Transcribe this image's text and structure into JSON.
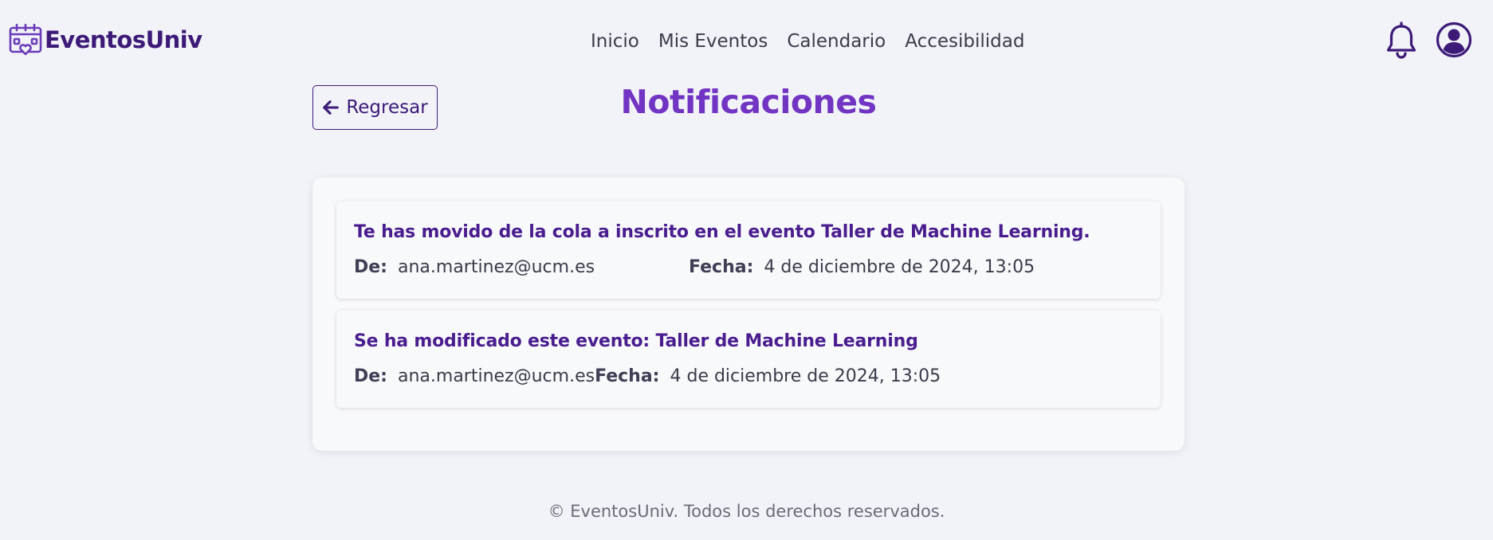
{
  "brand": {
    "name": "EventosUniv",
    "icon": "calendar-heart-icon"
  },
  "nav": {
    "links": [
      "Inicio",
      "Mis Eventos",
      "Calendario",
      "Accesibilidad"
    ],
    "notifications_icon": "bell-icon",
    "user_icon": "user-circle-icon"
  },
  "page": {
    "back_label": "Regresar",
    "back_icon": "arrow-left-icon",
    "title": "Notificaciones"
  },
  "notifications": [
    {
      "title": "Te has movido de la cola a inscrito en el evento Taller de Machine Learning.",
      "from_label": "De:",
      "from": "ana.martinez@ucm.es",
      "date_label": "Fecha:",
      "date": "4 de diciembre de 2024, 13:05"
    },
    {
      "title": "Se ha modificado este evento: Taller de Machine Learning",
      "from_label": "De:",
      "from": "ana.martinez@ucm.es",
      "date_label": "Fecha:",
      "date": "4 de diciembre de 2024, 13:05"
    }
  ],
  "footer": {
    "text": "© EventosUniv. Todos los derechos reservados."
  },
  "colors": {
    "brand": "#3d1a78",
    "title": "#7235c3",
    "notification_title": "#4a1d8f",
    "background": "#f1f3f8"
  }
}
